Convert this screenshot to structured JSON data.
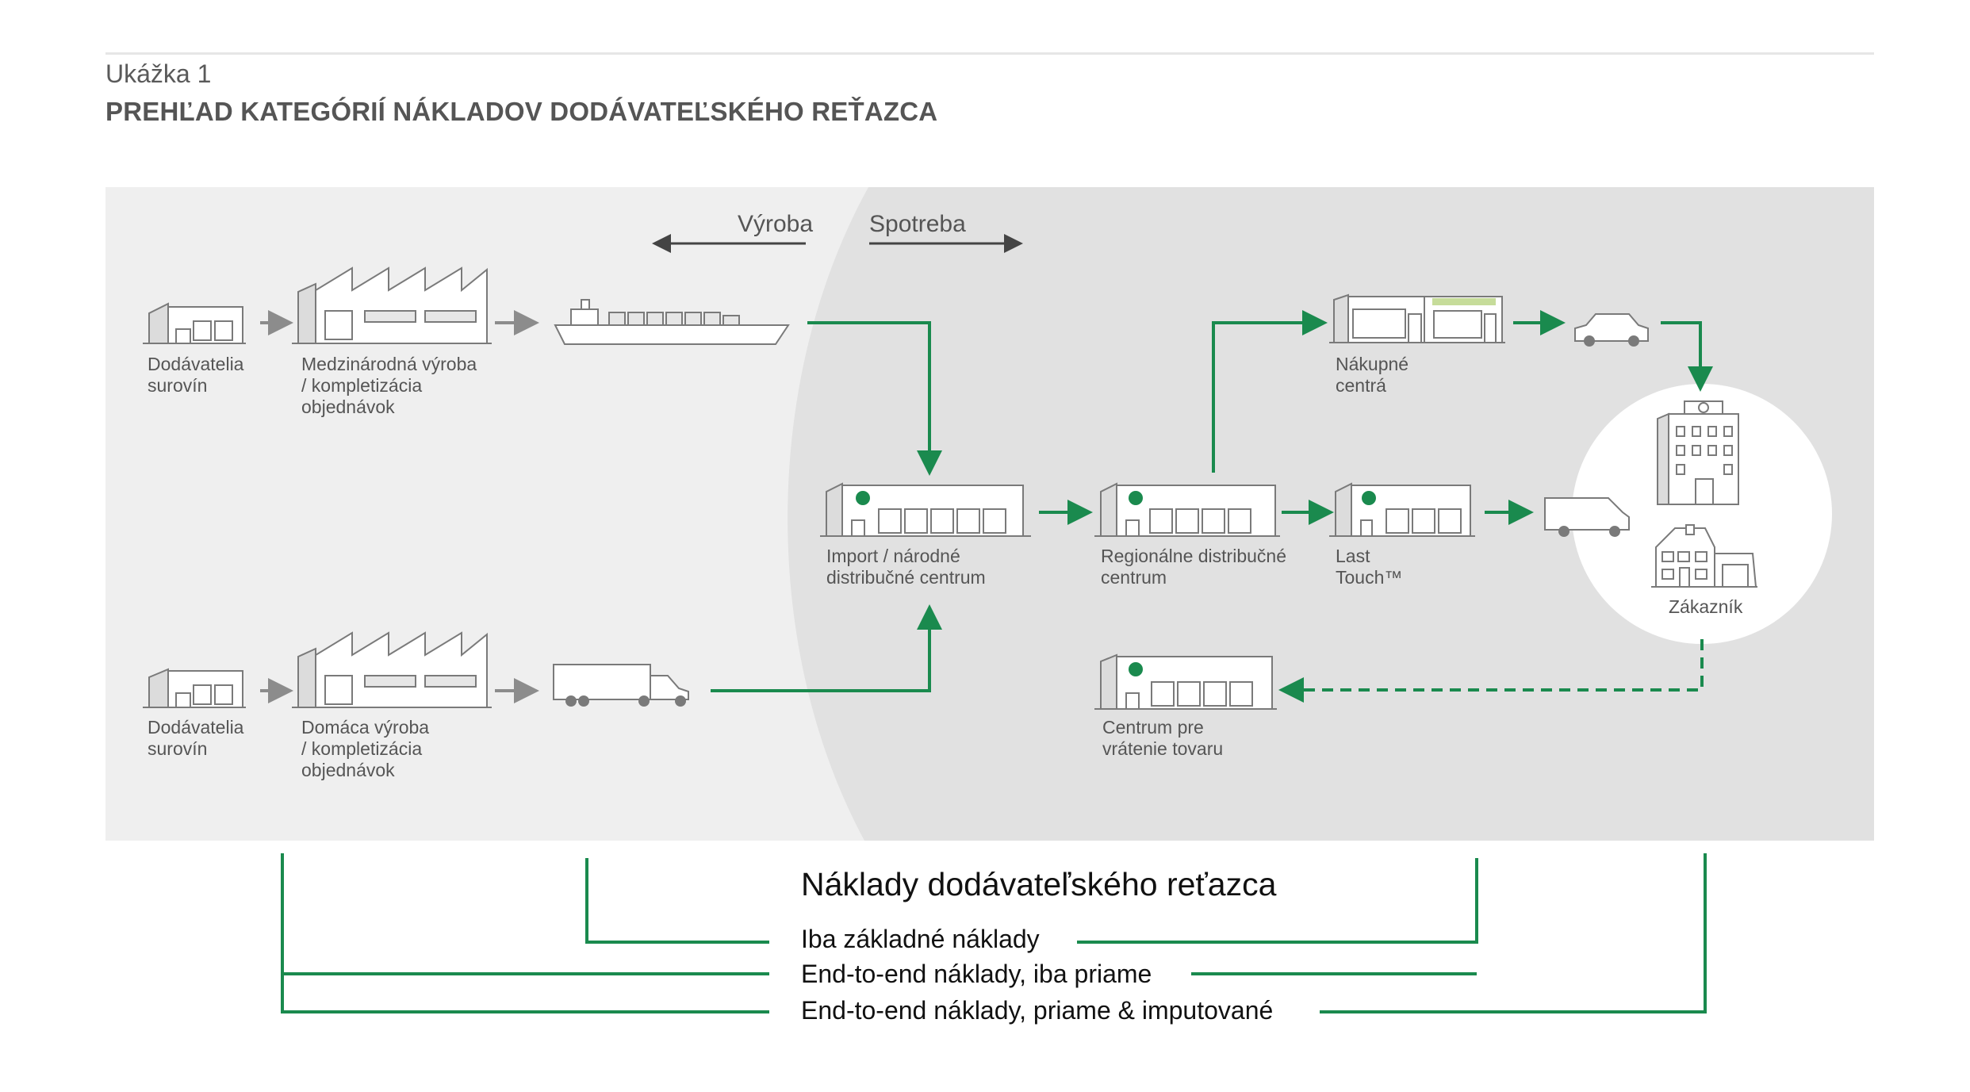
{
  "header": {
    "exhibit": "Ukážka 1",
    "title": "PREHĽAD KATEGÓRIÍ NÁKLADOV DODÁVATEĽSKÉHO REŤAZCA"
  },
  "zones": {
    "production": "Výroba",
    "consumption": "Spotreba"
  },
  "nodes": {
    "suppliers_top": "Dodávatelia\nsurovín",
    "intl_production": "Medzinárodná výroba\n/ kompletizácia\nobjednávok",
    "import_dc": "Import / národné\ndistribučné centrum",
    "regional_dc": "Regionálne distribučné\ncentrum",
    "last_touch": "Last\nTouch™",
    "shopping_centers": "Nákupné\ncentrá",
    "customer": "Zákazník",
    "suppliers_bottom": "Dodávatelia\nsurovín",
    "domestic_production": "Domáca výroba\n/ kompletizácia\nobjednávok",
    "returns_center": "Centrum pre\nvrátenie tovaru"
  },
  "costs": {
    "title": "Náklady dodávateľského reťazca",
    "items": [
      "Iba základné náklady",
      "End-to-end náklady, iba priame",
      "End-to-end náklady, priame & imputované"
    ]
  },
  "colors": {
    "accent_green": "#1a8a4e",
    "gray_arrow": "#8c8c8c",
    "panel_light": "#efefef",
    "panel_dark": "#e1e1e1"
  }
}
